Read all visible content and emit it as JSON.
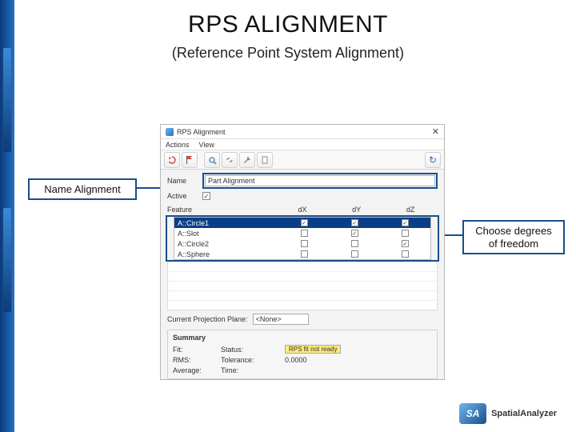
{
  "title": "RPS ALIGNMENT",
  "subtitle": "(Reference Point System Alignment)",
  "callouts": {
    "name": "Name Alignment",
    "dof": "Choose degrees of freedom"
  },
  "dialog": {
    "title": "RPS Alignment",
    "menu": {
      "actions": "Actions",
      "view": "View"
    },
    "toolbar": {
      "icons": [
        "undo-icon",
        "flag-icon",
        "goto-icon",
        "link-icon",
        "wrench-icon",
        "doc-icon"
      ],
      "refresh": "↻"
    },
    "name_label": "Name",
    "name_value": "Part Alignment",
    "active_label": "Active",
    "active_checked": "✓",
    "columns": {
      "feature": "Feature",
      "dx": "dX",
      "dy": "dY",
      "dz": "dZ"
    },
    "rows": [
      {
        "name": "A::Circle1",
        "dx": true,
        "dy": true,
        "dz": true,
        "selected": true
      },
      {
        "name": "A::Slot",
        "dx": false,
        "dy": true,
        "dz": false,
        "selected": false
      },
      {
        "name": "A::Circle2",
        "dx": false,
        "dy": false,
        "dz": true,
        "selected": false
      },
      {
        "name": "A::Sphere",
        "dx": false,
        "dy": false,
        "dz": false,
        "selected": false
      }
    ],
    "proj_label": "Current Projection Plane:",
    "proj_value": "<None>",
    "summary": {
      "heading": "Summary",
      "rows": [
        {
          "l1": "Fit:",
          "l2": "Status:",
          "v": "RPS fit not ready"
        },
        {
          "l1": "RMS:",
          "l2": "Tolerance:",
          "v": "0.0000"
        },
        {
          "l1": "Average:",
          "l2": "Time:",
          "v": ""
        }
      ]
    }
  },
  "footer": {
    "brand": "SpatialAnalyzer"
  }
}
